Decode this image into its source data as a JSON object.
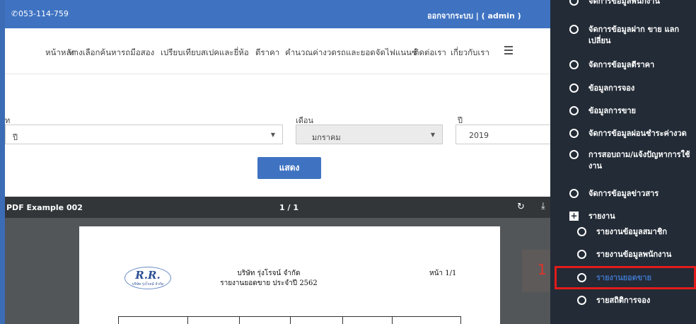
{
  "topbar": {
    "phone": "053-114-759",
    "logout": "ออกจากระบบ | ( admin )"
  },
  "nav": {
    "items": [
      "หน้าหลัก",
      "ทางเลือกค้นหารถมือสอง",
      "เปรียบเทียบสเปคและยี่ห้อ",
      "ตีราคา",
      "คำนวณค่างวดรถและยอดจัดไฟแนนซ์",
      "ติดต่อเรา",
      "เกี่ยวกับเรา"
    ]
  },
  "form": {
    "type_label": "ท",
    "type_value": "ปี",
    "month_label": "เดือน",
    "month_value": "มกราคม",
    "year_label": "ปี",
    "year_value": "2019",
    "show_button": "แสดง"
  },
  "pdf": {
    "name": "PDF Example 002",
    "pages": "1 / 1",
    "logo_text": "R.R.",
    "logo_sub": "บริษัท รุ่งโรจน์ จำกัด",
    "company": "บริษัท รุ่งโรจน์ จำกัด",
    "title": "รายงานยอดขาย ประจำปี 2562",
    "page_no": "หน้า 1/1"
  },
  "annotation_number": "1",
  "sidebar": {
    "items": [
      "จัดการข้อมูลพนักงาน",
      "จัดการข้อมูลฝาก ขาย แลก เปลี่ยน",
      "จัดการข้อมูลตีราคา",
      "ข้อมูลการจอง",
      "ข้อมูลการขาย",
      "จัดการข้อมูลผ่อนชำระค่างวด",
      "การสอบถาม/แจ้งปัญหาการใช้งาน",
      "จัดการข้อมูลข่าวสาร"
    ],
    "report_header": "รายงาน",
    "reports": [
      "รายงานข้อมูลสมาชิก",
      "รายงานข้อมูลพนักงาน",
      "รายงานยอดขาย",
      "รายสถิติการจอง"
    ]
  },
  "colors": {
    "primary": "#3f73c2",
    "sidebar_bg": "#222b36",
    "highlight": "#e21b1b"
  }
}
